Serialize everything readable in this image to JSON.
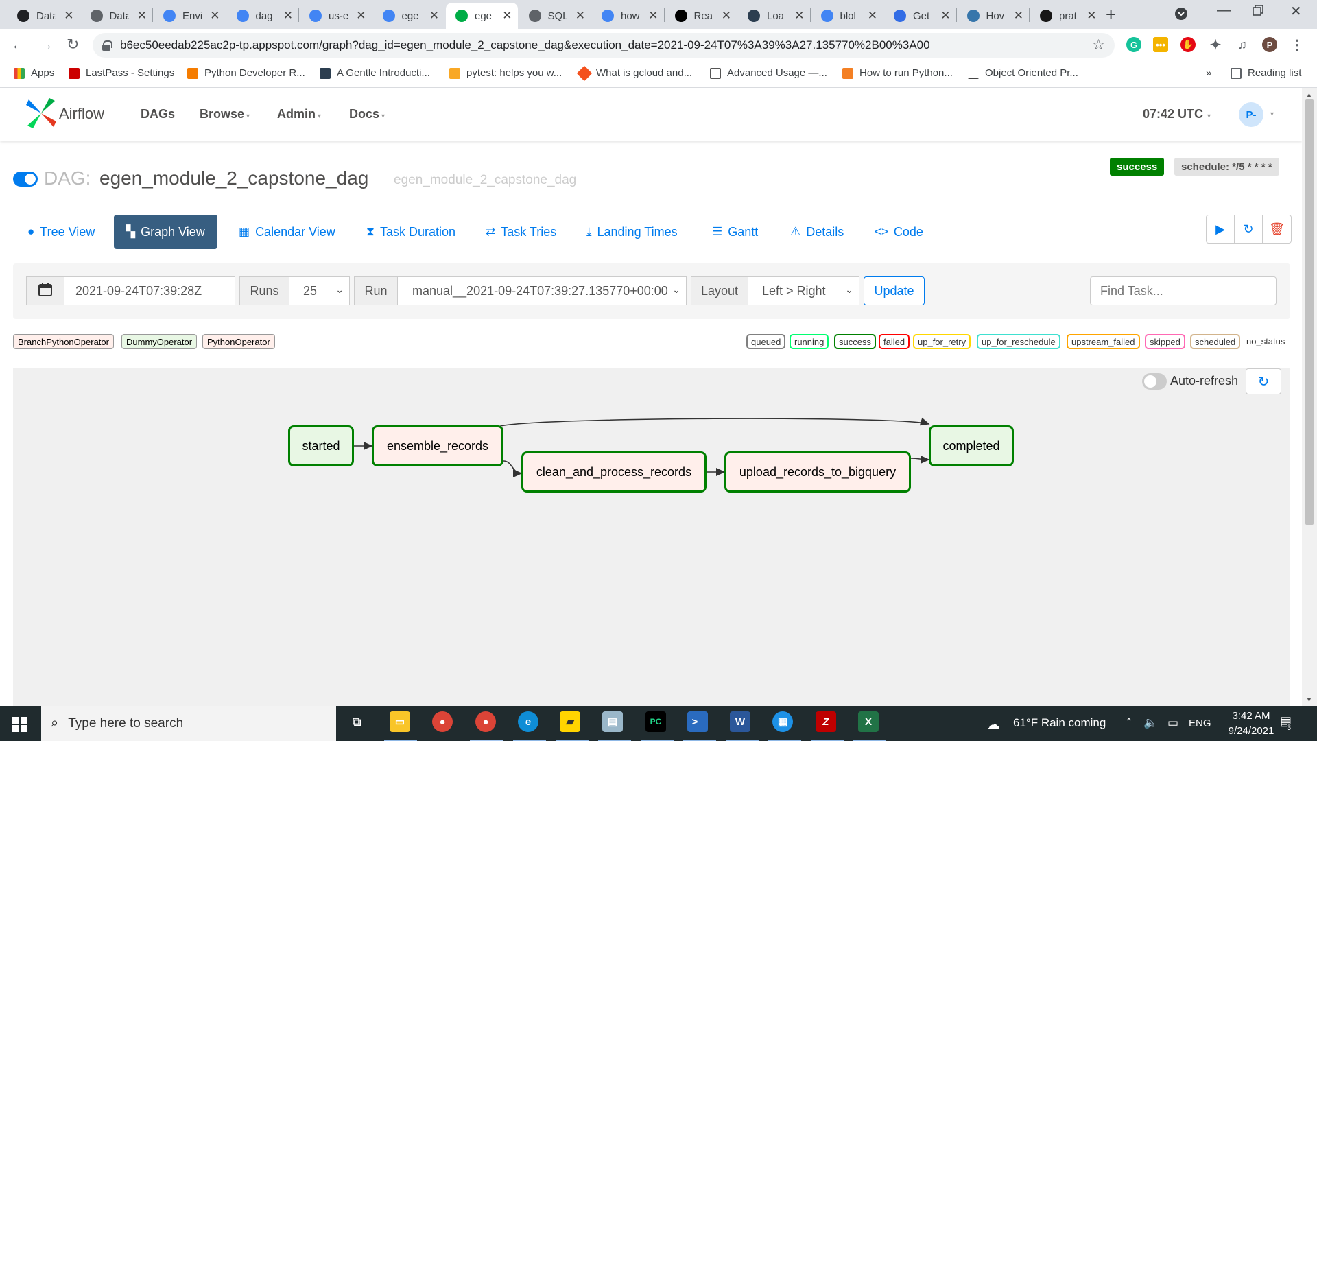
{
  "browser": {
    "tabs": [
      {
        "title": "Data",
        "favicon": "toggle-icon",
        "color": "#202124"
      },
      {
        "title": "Data",
        "favicon": "globe-icon",
        "color": "#5f6368"
      },
      {
        "title": "Envi",
        "favicon": "gcp-icon",
        "color": "#4285f4"
      },
      {
        "title": "dag",
        "favicon": "storage-icon",
        "color": "#4285f4"
      },
      {
        "title": "us-e",
        "favicon": "storage-icon",
        "color": "#4285f4"
      },
      {
        "title": "ege",
        "favicon": "storage-icon",
        "color": "#4285f4"
      },
      {
        "title": "ege",
        "favicon": "airflow-icon",
        "color": "#00ad46",
        "active": true
      },
      {
        "title": "SQL",
        "favicon": "gear-icon",
        "color": "#5f6368"
      },
      {
        "title": "how",
        "favicon": "google-icon",
        "color": "#4285f4"
      },
      {
        "title": "Rea",
        "favicon": "medium-icon",
        "color": "#000000"
      },
      {
        "title": "Loa",
        "favicon": "tds-icon",
        "color": "#2c3e50"
      },
      {
        "title": "blol",
        "favicon": "google-icon",
        "color": "#4285f4"
      },
      {
        "title": "Get",
        "favicon": "k8s-icon",
        "color": "#326ce5"
      },
      {
        "title": "Hov",
        "favicon": "python-icon",
        "color": "#3776ab"
      },
      {
        "title": "prat",
        "favicon": "github-icon",
        "color": "#181717"
      }
    ],
    "url": "b6ec50eedab225ac2p-tp.appspot.com/graph?dag_id=egen_module_2_capstone_dag&execution_date=2021-09-24T07%3A39%3A27.135770%2B00%3A00",
    "bookmarks": [
      {
        "label": "Apps",
        "color": "#ea4335"
      },
      {
        "label": "LastPass - Settings",
        "color": "#cc0000"
      },
      {
        "label": "Python Developer R...",
        "color": "#f57c00"
      },
      {
        "label": "A Gentle Introducti...",
        "color": "#2c3e50"
      },
      {
        "label": "pytest: helps you w...",
        "color": "#f9a825"
      },
      {
        "label": "What is gcloud and...",
        "color": "#f4511e"
      },
      {
        "label": "Advanced Usage —...",
        "color": "#555555"
      },
      {
        "label": "How to run Python...",
        "color": "#f48024"
      },
      {
        "label": "Object Oriented Pr...",
        "color": "#444444"
      }
    ],
    "bookmarks_overflow": "»",
    "reading_list": "Reading list"
  },
  "airflow": {
    "brand": "Airflow",
    "menu": [
      "DAGs",
      "Browse",
      "Admin",
      "Docs"
    ],
    "time": "07:42 UTC",
    "user_initials": "P-",
    "dag_prefix": "DAG:",
    "dag_id": "egen_module_2_capstone_dag",
    "dag_subtitle": "egen_module_2_capstone_dag",
    "status": "success",
    "schedule": "schedule: */5 * * * *",
    "views": [
      {
        "label": "Tree View",
        "icon": "tree-icon"
      },
      {
        "label": "Graph View",
        "icon": "graph-icon",
        "active": true
      },
      {
        "label": "Calendar View",
        "icon": "calendar-icon"
      },
      {
        "label": "Task Duration",
        "icon": "hourglass-icon"
      },
      {
        "label": "Task Tries",
        "icon": "retry-icon"
      },
      {
        "label": "Landing Times",
        "icon": "landing-icon"
      },
      {
        "label": "Gantt",
        "icon": "gantt-icon"
      },
      {
        "label": "Details",
        "icon": "warning-icon"
      },
      {
        "label": "Code",
        "icon": "code-icon"
      }
    ],
    "form": {
      "date": "2021-09-24T07:39:28Z",
      "runs_label": "Runs",
      "runs_value": "25",
      "run_label": "Run",
      "run_value": "manual__2021-09-24T07:39:27.135770+00:00",
      "layout_label": "Layout",
      "layout_value": "Left > Right",
      "update_label": "Update",
      "find_placeholder": "Find Task..."
    },
    "operators": [
      {
        "label": "BranchPythonOperator",
        "color": "#ffefeb"
      },
      {
        "label": "DummyOperator",
        "color": "#e8f7e4"
      },
      {
        "label": "PythonOperator",
        "color": "#ffefeb"
      }
    ],
    "states": [
      {
        "label": "queued",
        "color": "#808080"
      },
      {
        "label": "running",
        "color": "#01ff70"
      },
      {
        "label": "success",
        "color": "#008000"
      },
      {
        "label": "failed",
        "color": "#ff0000"
      },
      {
        "label": "up_for_retry",
        "color": "#ffd700"
      },
      {
        "label": "up_for_reschedule",
        "color": "#40e0d0"
      },
      {
        "label": "upstream_failed",
        "color": "#ffa500"
      },
      {
        "label": "skipped",
        "color": "#ff69b4"
      },
      {
        "label": "scheduled",
        "color": "#d2b48c"
      },
      {
        "label": "no_status",
        "color": ""
      }
    ],
    "auto_refresh_label": "Auto-refresh",
    "graph": {
      "nodes": [
        {
          "id": "started",
          "label": "started",
          "operator": "DummyOperator",
          "state": "success"
        },
        {
          "id": "ensemble_records",
          "label": "ensemble_records",
          "operator": "BranchPythonOperator",
          "state": "success"
        },
        {
          "id": "clean_and_process_records",
          "label": "clean_and_process_records",
          "operator": "PythonOperator",
          "state": "success"
        },
        {
          "id": "upload_records_to_bigquery",
          "label": "upload_records_to_bigquery",
          "operator": "PythonOperator",
          "state": "success"
        },
        {
          "id": "completed",
          "label": "completed",
          "operator": "DummyOperator",
          "state": "success"
        }
      ],
      "edges": [
        [
          "started",
          "ensemble_records"
        ],
        [
          "ensemble_records",
          "clean_and_process_records"
        ],
        [
          "ensemble_records",
          "completed"
        ],
        [
          "clean_and_process_records",
          "upload_records_to_bigquery"
        ],
        [
          "upload_records_to_bigquery",
          "completed"
        ]
      ]
    }
  },
  "taskbar": {
    "search_placeholder": "Type here to search",
    "weather": "61°F  Rain coming",
    "language": "ENG",
    "time": "3:42 AM",
    "date": "9/24/2021",
    "notifications": "3"
  }
}
